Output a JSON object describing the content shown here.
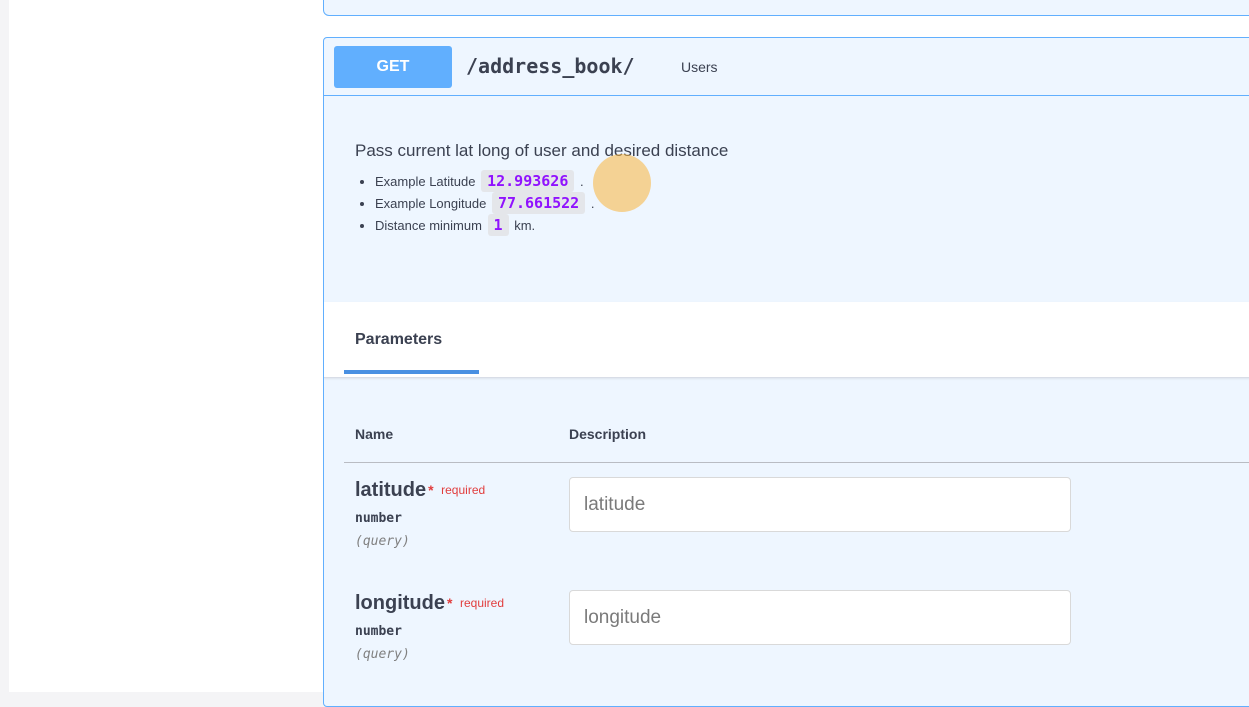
{
  "operation": {
    "method": "GET",
    "path": "/address_book/",
    "summary": "Users",
    "description": {
      "lead": "Pass current lat long of user and desired distance",
      "items": [
        {
          "label": "Example Latitude",
          "value": "12.993626",
          "suffix": "."
        },
        {
          "label": "Example Longitude",
          "value": "77.661522",
          "suffix": "."
        },
        {
          "label": "Distance minimum",
          "value": "1",
          "suffix": "km."
        }
      ]
    }
  },
  "parameters": {
    "tab_label": "Parameters",
    "columns": {
      "name": "Name",
      "description": "Description"
    },
    "rows": [
      {
        "name": "latitude",
        "star": "*",
        "required": "required",
        "type": "number",
        "in": "(query)",
        "placeholder": "latitude"
      },
      {
        "name": "longitude",
        "star": "*",
        "required": "required",
        "type": "number",
        "in": "(query)",
        "placeholder": "longitude"
      }
    ]
  },
  "colors": {
    "get_method": "#61affe",
    "block_background": "#eef6ff",
    "required": "#e13d3d",
    "code": "#9012fe",
    "tab_underline": "#4990e2"
  }
}
